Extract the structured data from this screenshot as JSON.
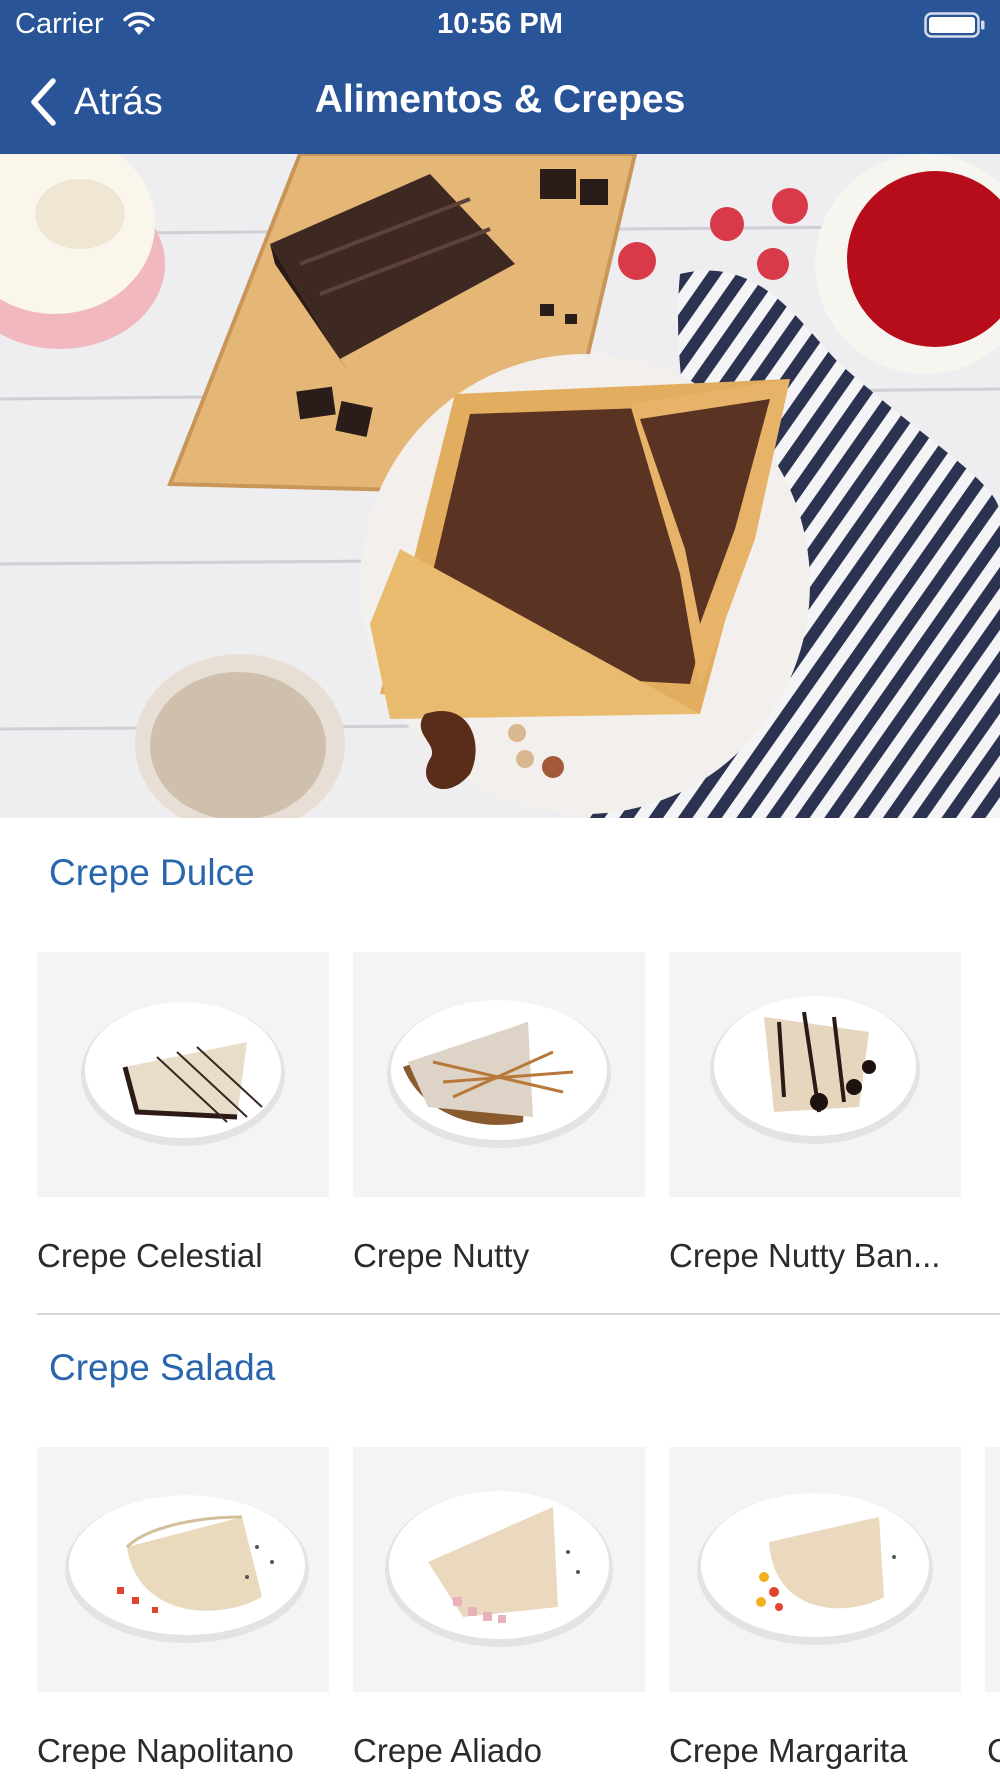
{
  "status_bar": {
    "carrier": "Carrier",
    "time": "10:56 PM"
  },
  "nav": {
    "back_label": "Atrás",
    "title": "Alimentos & Crepes"
  },
  "sections": [
    {
      "title": "Crepe Dulce",
      "items": [
        {
          "label": "Crepe Celestial"
        },
        {
          "label": "Crepe Nutty"
        },
        {
          "label": "Crepe Nutty Ban..."
        }
      ]
    },
    {
      "title": "Crepe Salada",
      "items": [
        {
          "label": "Crepe Napolitano"
        },
        {
          "label": "Crepe Aliado"
        },
        {
          "label": "Crepe Margarita"
        }
      ]
    }
  ],
  "peek_label": "C",
  "colors": {
    "nav_bar": "#2a5498",
    "section_title": "#2a66ad"
  }
}
